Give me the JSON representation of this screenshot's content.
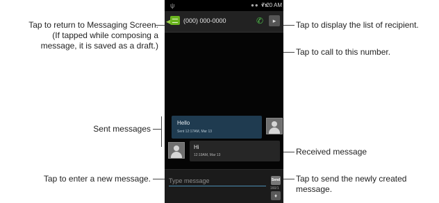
{
  "annotations": {
    "return_lines": [
      "Tap to return to Messaging Screen.",
      "(If tapped while composing a",
      "message, it is saved as a draft.)"
    ],
    "display_list": "Tap to display the list of recipient.",
    "call": "Tap to call to this number.",
    "sent_messages": "Sent messages",
    "received_message": "Received message",
    "new_message": "Tap to enter a new message.",
    "send_lines": [
      "Tap to send the newly created",
      "message."
    ]
  },
  "phone": {
    "status_bar": {
      "time": "7:20 AM"
    },
    "header": {
      "contact": "(000) 000-0000"
    },
    "sent_bubble": {
      "text": "Hello",
      "meta": "Sent 12:17AM, Mar 13"
    },
    "received_bubble": {
      "text": "Hi",
      "meta": "12:19AM, Mar 13"
    },
    "composer": {
      "placeholder": "Type message",
      "send_label": "Send",
      "counter": "160/1"
    }
  },
  "icons": [
    "signal-icon",
    "back-arrow-icon",
    "message-icon",
    "call-icon",
    "contact-list-icon",
    "avatar-icon",
    "attach-icon"
  ],
  "colors": {
    "accent_green": "#6ab41f",
    "call_green": "#4ec24a",
    "sent_bubble": "#1f3b50",
    "input_underline": "#4b8fb5"
  }
}
